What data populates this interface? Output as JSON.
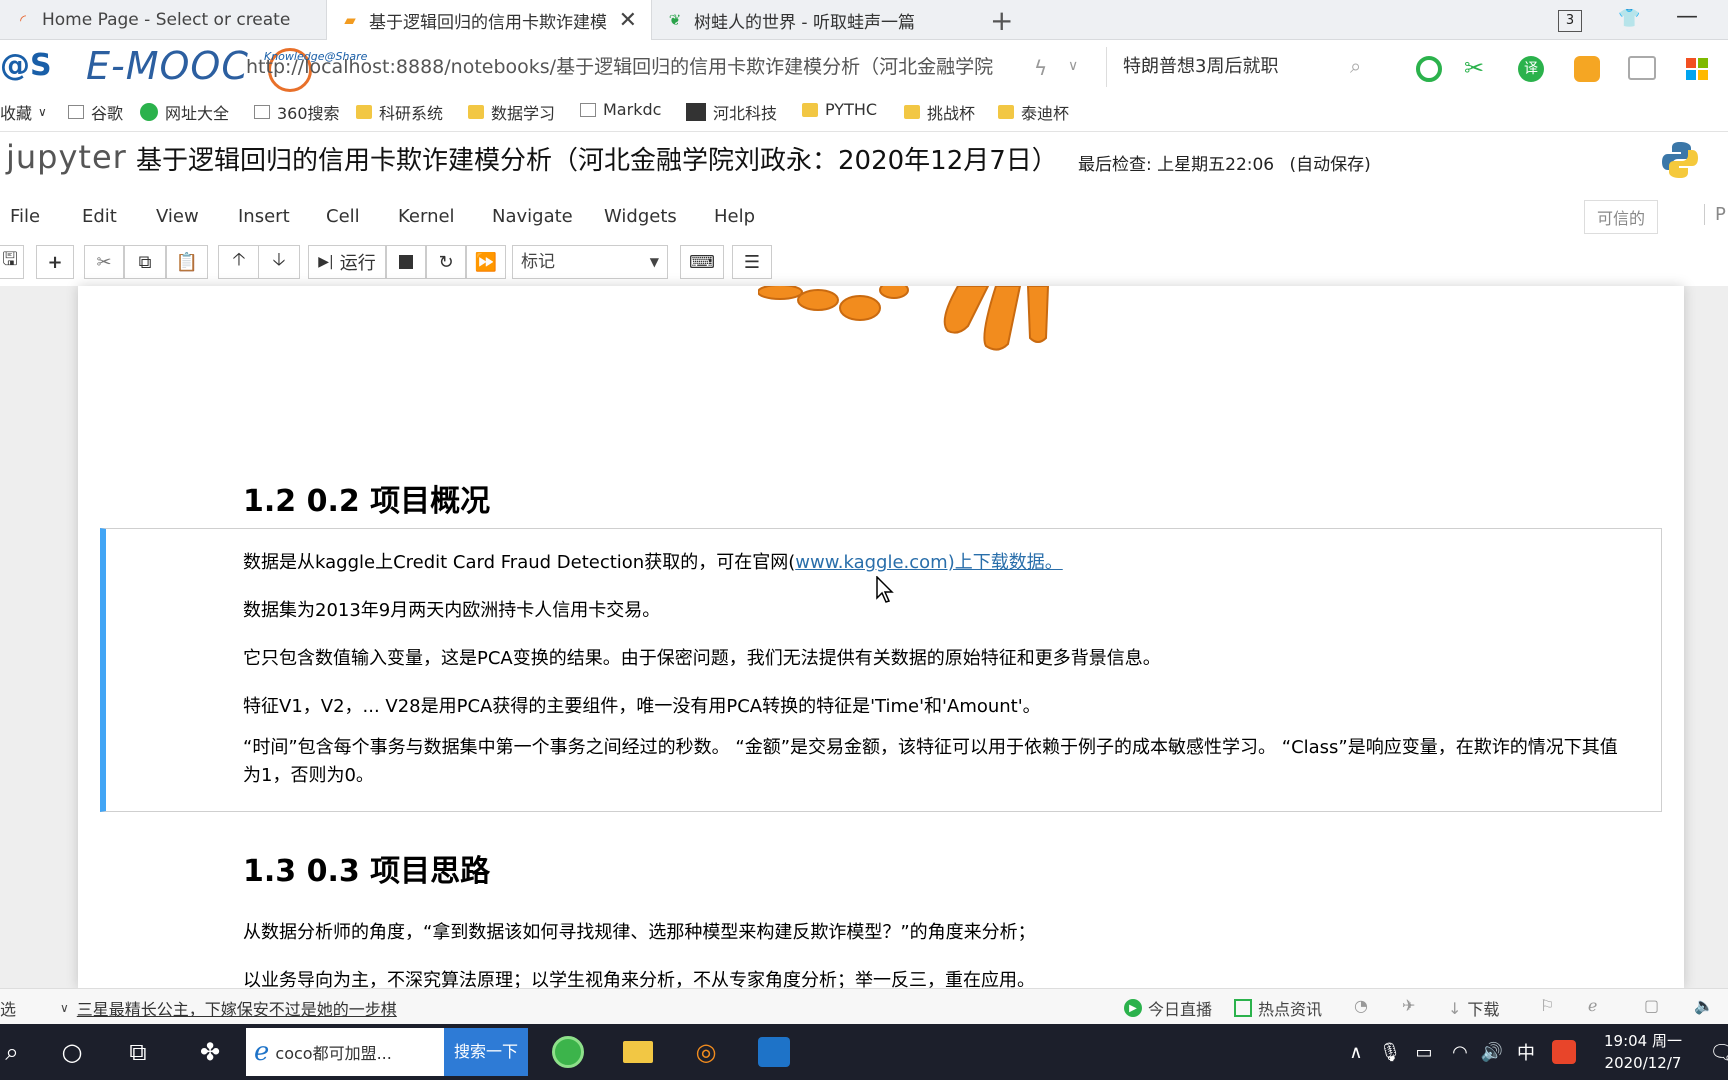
{
  "browser": {
    "tabs": [
      {
        "title": "Home Page - Select or create"
      },
      {
        "title": "基于逻辑回归的信用卡欺诈建模"
      },
      {
        "title": "树蛙人的世界 - 听取蛙声一篇"
      }
    ],
    "new_tab": "+",
    "window_count": "3",
    "url": "http://localhost:8888/notebooks/基于逻辑回归的信用卡欺诈建模分析（河北金融学院",
    "search_text": "特朗普想3周后就职",
    "logo_text": "E-MOOC",
    "logo_small": "Knowledge@Share",
    "logo_left": "@S"
  },
  "bookmarks": [
    {
      "label": "收藏",
      "type": "menu"
    },
    {
      "label": "谷歌",
      "type": "page"
    },
    {
      "label": "网址大全",
      "type": "site"
    },
    {
      "label": "360搜索",
      "type": "page"
    },
    {
      "label": "科研系统",
      "type": "folder"
    },
    {
      "label": "数据学习",
      "type": "folder"
    },
    {
      "label": "Markdc",
      "type": "page"
    },
    {
      "label": "河北科技",
      "type": "site"
    },
    {
      "label": "PYTHC",
      "type": "folder"
    },
    {
      "label": "挑战杯",
      "type": "folder"
    },
    {
      "label": "泰迪杯",
      "type": "folder"
    }
  ],
  "jupyter": {
    "logo": "jupyter",
    "title": "基于逻辑回归的信用卡欺诈建模分析（河北金融学院刘政永：2020年12月7日）",
    "checkpoint": "最后检查: 上星期五22:06",
    "autosave": "(自动保存)",
    "menu": [
      "File",
      "Edit",
      "View",
      "Insert",
      "Cell",
      "Kernel",
      "Navigate",
      "Widgets",
      "Help"
    ],
    "trusted": "可信的",
    "kernel_hint": "P",
    "run_label": "运行",
    "cell_type": "标记"
  },
  "notebook": {
    "section_1": "1.2  0.2 项目概况",
    "para_1_prefix": "数据是从kaggle上Credit Card Fraud Detection获取的，可在官网(",
    "para_1_link": "www.kaggle.com)上下载数据。",
    "para_2": "数据集为2013年9月两天内欧洲持卡人信用卡交易。",
    "para_3": "它只包含数值输入变量，这是PCA变换的结果。由于保密问题，我们无法提供有关数据的原始特征和更多背景信息。",
    "para_4": "特征V1，V2，... V28是用PCA获得的主要组件，唯一没有用PCA转换的特征是'Time'和'Amount'。",
    "para_5": "“时间”包含每个事务与数据集中第一个事务之间经过的秒数。 “金额”是交易金额，该特征可以用于依赖于例子的成本敏感性学习。 “Class”是响应变量，在欺诈的情况下其值为1，否则为0。",
    "section_2": "1.3  0.3 项目思路",
    "para_6": "从数据分析师的角度，“拿到数据该如何寻找规律、选那种模型来构建反欺诈模型？”的角度来分析；",
    "para_7": "以业务导向为主，不深究算法原理；以学生视角来分析，不从专家角度分析；举一反三，重在应用。"
  },
  "statusbar": {
    "left": "选",
    "news": "三星最精长公主，下嫁保安不过是她的一步棋",
    "live": "今日直播",
    "hot": "热点资讯",
    "download": "下载"
  },
  "taskbar": {
    "search_text": "coco都可加盟...",
    "search_button": "搜索一下",
    "ime": "中",
    "time": "19:04 周一",
    "date": "2020/12/7"
  },
  "colors": {
    "cell_accent": "#42a5f5",
    "link": "#296eaa",
    "taskbar": "#1c1f2b"
  }
}
